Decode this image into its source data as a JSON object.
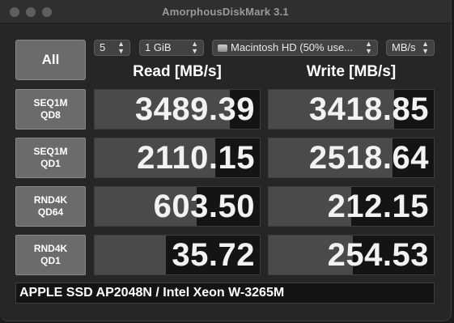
{
  "window": {
    "title": "AmorphousDiskMark 3.1"
  },
  "controls": {
    "all_button": "All",
    "count": "5",
    "size": "1 GiB",
    "target": "Macintosh HD (50% use...",
    "unit": "MB/s"
  },
  "columns": {
    "read": "Read [MB/s]",
    "write": "Write [MB/s]"
  },
  "rows": [
    {
      "line1": "SEQ1M",
      "line2": "QD8",
      "read": "3489.39",
      "write": "3418.85",
      "read_fill": 0.82,
      "write_fill": 0.76
    },
    {
      "line1": "SEQ1M",
      "line2": "QD1",
      "read": "2110.15",
      "write": "2518.64",
      "read_fill": 0.73,
      "write_fill": 0.75
    },
    {
      "line1": "RND4K",
      "line2": "QD64",
      "read": "603.50",
      "write": "212.15",
      "read_fill": 0.62,
      "write_fill": 0.5
    },
    {
      "line1": "RND4K",
      "line2": "QD1",
      "read": "35.72",
      "write": "254.53",
      "read_fill": 0.43,
      "write_fill": 0.51
    }
  ],
  "status_text": "APPLE SSD AP2048N / Intel Xeon W-3265M",
  "colors": {
    "background": "#262626",
    "button": "#6b6b6b",
    "cell": "#141414",
    "bar": "#4a4a4a",
    "text": "#f2f2f2"
  }
}
